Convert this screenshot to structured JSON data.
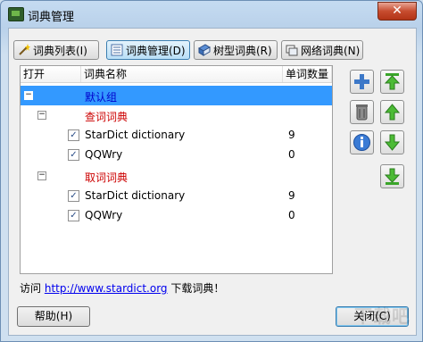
{
  "window": {
    "title": "词典管理",
    "close_glyph": "✕"
  },
  "tabs": [
    {
      "label": "词典列表(I)",
      "icon": "wand-icon"
    },
    {
      "label": "词典管理(D)",
      "icon": "list-icon"
    },
    {
      "label": "树型词典(R)",
      "icon": "book-icon"
    },
    {
      "label": "网络词典(N)",
      "icon": "windows-icon"
    }
  ],
  "list": {
    "headers": [
      "打开",
      "词典名称",
      "单词数量"
    ],
    "groups": [
      {
        "label": "默认组",
        "toggle": "−",
        "selected": true
      },
      {
        "label": "查词词典",
        "toggle": "−",
        "items": [
          {
            "name": "StarDict dictionary",
            "count": "9",
            "checked": "✓"
          },
          {
            "name": "QQWry",
            "count": "0",
            "checked": "✓"
          }
        ]
      },
      {
        "label": "取词词典",
        "toggle": "−",
        "items": [
          {
            "name": "StarDict dictionary",
            "count": "9",
            "checked": "✓"
          },
          {
            "name": "QQWry",
            "count": "0",
            "checked": "✓"
          }
        ]
      }
    ]
  },
  "side_buttons": [
    "add-icon",
    "delete-icon",
    "info-icon",
    "move-top-icon",
    "move-up-icon",
    "move-down-icon",
    "move-bottom-icon"
  ],
  "footer": {
    "prefix": "访问",
    "link": "http://www.stardict.org",
    "suffix": "下载词典！"
  },
  "buttons": {
    "help": "帮助(H)",
    "close": "关闭(C)"
  },
  "watermark": "下载吧",
  "colors": {
    "selection": "#3399ff",
    "group_blue": "#0000cc",
    "group_red": "#cc0000",
    "link": "#0000ee"
  }
}
